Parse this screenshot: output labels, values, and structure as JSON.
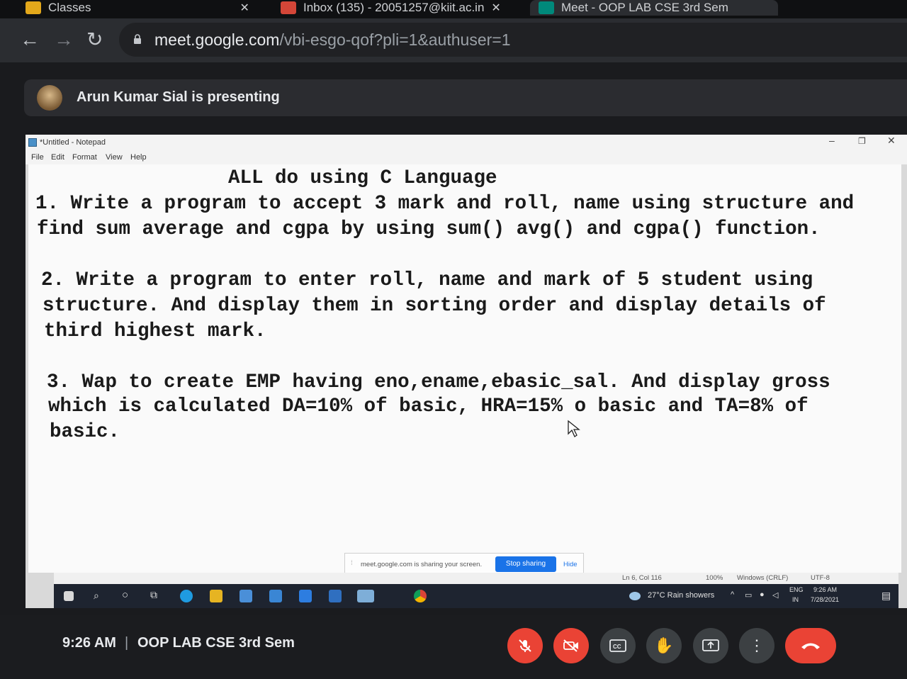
{
  "browser": {
    "tabs": [
      {
        "label": "Classes"
      },
      {
        "label": "Inbox (135) - 20051257@kiit.ac.in"
      },
      {
        "label": "Meet - OOP LAB CSE 3rd Sem"
      }
    ],
    "url_host": "meet.google.com",
    "url_path": "/vbi-esgo-qof?pli=1&authuser=1"
  },
  "meet": {
    "presenter_banner": "Arun Kumar Sial is presenting",
    "time": "9:26 AM",
    "separator": "|",
    "meeting_name": "OOP LAB CSE 3rd Sem"
  },
  "notepad": {
    "title": "*Untitled - Notepad",
    "menu": [
      "File",
      "Edit",
      "Format",
      "View",
      "Help"
    ],
    "lines": [
      "ALL do using C Language",
      "1. Write a program to accept 3 mark and roll, name using structure and",
      "find sum average and cgpa by using sum() avg() and cgpa() function.",
      "2. Write a program to enter roll, name and mark of 5 student using",
      "structure. And display them in sorting order and display details of",
      "third highest mark.",
      "3. Wap to create EMP having eno,ename,ebasic_sal. And display gross",
      "which is calculated DA=10% of basic, HRA=15% o basic and TA=8% of",
      "basic."
    ],
    "status": {
      "position": "Ln 6, Col 116",
      "zoom": "100%",
      "line_ending": "Windows (CRLF)",
      "encoding": "UTF-8"
    }
  },
  "share_notice": {
    "message": "meet.google.com is sharing your screen.",
    "stop": "Stop sharing",
    "hide": "Hide"
  },
  "taskbar": {
    "weather": "27°C  Rain showers",
    "lang1": "ENG",
    "lang2": "IN",
    "clock_time": "9:26 AM",
    "clock_date": "7/28/2021"
  },
  "colors": {
    "end_call": "#ea4335",
    "accent_blue": "#1a73e8"
  }
}
